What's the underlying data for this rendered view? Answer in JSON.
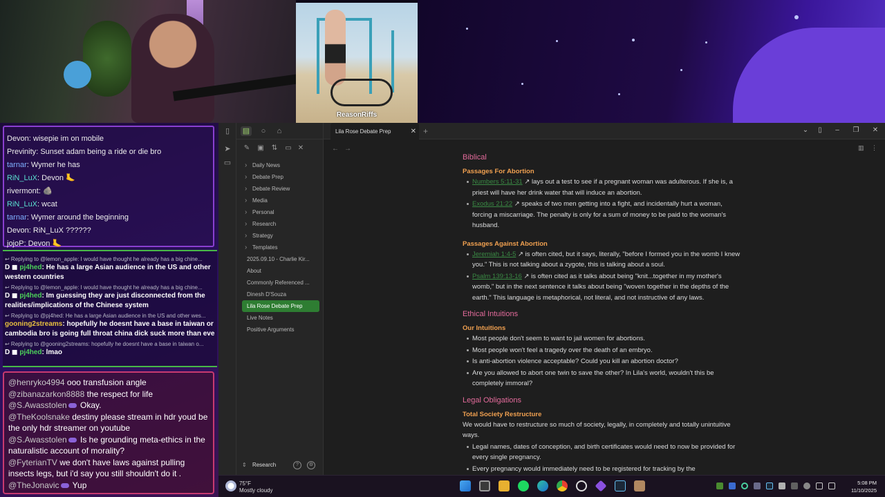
{
  "stream": {
    "overlay_tag": "ReasonRiffs"
  },
  "chat_top": [
    {
      "user": "Devon",
      "user_color": "#ececec",
      "text": "wisepie im on mobile"
    },
    {
      "user": "Previnity",
      "user_color": "#ececec",
      "text": "Sunset adam being a ride or die bro"
    },
    {
      "user": "tarnar",
      "user_color": "#7fb0ff",
      "text": "Wymer he has"
    },
    {
      "user": "RiN_LuX",
      "user_color": "#5ae0d0",
      "text": "Devon 🦶"
    },
    {
      "user": "rivermont",
      "user_color": "#ececec",
      "text": "🪨"
    },
    {
      "user": "RiN_LuX",
      "user_color": "#5ae0d0",
      "text": "wcat"
    },
    {
      "user": "tarnar",
      "user_color": "#7fb0ff",
      "text": "Wymer around the beginning"
    },
    {
      "user": "Devon",
      "user_color": "#ececec",
      "text": "RiN_LuX ??????"
    },
    {
      "user": "jojoP",
      "user_color": "#ececec",
      "text": "Devon 🦶"
    }
  ],
  "chat_mid": [
    {
      "reply": "↩ Replying to @lemon_apple: I would have thought he already has a big chine...",
      "user": "pj4hed",
      "user_color": "#4cd05a",
      "badge": "D ◼",
      "text": "He has a large Asian audience in the US and other western countries"
    },
    {
      "reply": "↩ Replying to @lemon_apple: I would have thought he already has a big chine...",
      "user": "pj4hed",
      "user_color": "#4cd05a",
      "badge": "D ◼",
      "text": "Im guessing they are just disconnected from the realities/implications of the Chinese system"
    },
    {
      "reply": "↩ Replying to @pj4hed: He has a large Asian audience in the US and other wes...",
      "user": "gooning2streams",
      "user_color": "#e8c040",
      "badge": "",
      "text": "hopefully he doesnt have a base in taiwan or cambodia bro is going full throat china dick suck more than eve"
    },
    {
      "reply": "↩ Replying to @gooning2streams: hopefully he doesnt have a base in taiwan o...",
      "user": "pj4hed",
      "user_color": "#4cd05a",
      "badge": "D ◼",
      "text": "lmao"
    }
  ],
  "chat_bottom": [
    {
      "user": "@henryko4994",
      "dot": false,
      "text": "ooo transfusion angle"
    },
    {
      "user": "@zibanazarkon8888",
      "dot": false,
      "text": "the respect for life"
    },
    {
      "user": "@S.Awasstolen",
      "dot": true,
      "text": "Okay."
    },
    {
      "user": "@TheKoolsnake",
      "dot": false,
      "text": "destiny please stream in hdr youd be the only hdr streamer on youtube"
    },
    {
      "user": "@S.Awasstolen",
      "dot": true,
      "text": "Is he grounding meta-ethics in the naturalistic account of morality?"
    },
    {
      "user": "@FyterianTV",
      "dot": false,
      "text": "we don't have laws against pulling insects legs, but i'd say you still shouldn't do it ."
    },
    {
      "user": "@TheJonavic",
      "dot": true,
      "text": "Yup"
    }
  ],
  "obsidian": {
    "tab_title": "Lila Rose Debate Prep",
    "sidebar_items": [
      {
        "label": "Daily News",
        "type": "folder"
      },
      {
        "label": "Debate Prep",
        "type": "folder"
      },
      {
        "label": "Debate Review",
        "type": "folder"
      },
      {
        "label": "Media",
        "type": "folder"
      },
      {
        "label": "Personal",
        "type": "folder"
      },
      {
        "label": "Research",
        "type": "folder"
      },
      {
        "label": "Strategy",
        "type": "folder"
      },
      {
        "label": "Templates",
        "type": "folder"
      },
      {
        "label": "2025.09.10 - Charlie Kir...",
        "type": "file"
      },
      {
        "label": "About",
        "type": "file"
      },
      {
        "label": "Commonly Referenced ...",
        "type": "file"
      },
      {
        "label": "Dinesh D'Souza",
        "type": "file"
      },
      {
        "label": "Lila Rose Debate Prep",
        "type": "file",
        "selected": true
      },
      {
        "label": "Live Notes",
        "type": "file"
      },
      {
        "label": "Positive Arguments",
        "type": "file"
      }
    ],
    "vault_name": "Research",
    "note": {
      "biblical": {
        "heading": "Biblical",
        "for": {
          "heading": "Passages For Abortion",
          "items": [
            {
              "link": "Numbers 5:11-31",
              "text": "lays out a test to see if a pregnant woman was adulterous. If she is, a priest will have her drink water that will induce an abortion."
            },
            {
              "link": "Exodus 21:22",
              "text": "speaks of two men getting into a fight, and incidentally hurt a woman, forcing a miscarriage. The penalty is only for a sum of money to be paid to the woman's husband."
            }
          ]
        },
        "against": {
          "heading": "Passages Against Abortion",
          "items": [
            {
              "link": "Jeremiah 1:4-5",
              "text": "is often cited, but it says, literally, \"before I formed you in the womb I knew you.\" This is not talking about a zygote, this is talking about a soul."
            },
            {
              "link": "Psalm 139:13-16",
              "text": "is often cited as it talks about being \"knit...together in my mother's womb,\" but in the next sentence it talks about being \"woven together in the depths of the earth.\" This language is metaphorical, not literal, and not instructive of any laws."
            }
          ]
        }
      },
      "ethical": {
        "heading": "Ethical Intuitions",
        "sub_heading": "Our Intuitions",
        "items": [
          "Most people don't seem to want to jail women for abortions.",
          "Most people won't feel a tragedy over the death of an embryo.",
          "Is anti-abortion violence acceptable? Could you kill an abortion doctor?",
          "Are you allowed to abort one twin to save the other? In Lila's world, wouldn't this be completely immoral?"
        ]
      },
      "legal": {
        "heading": "Legal Obligations",
        "sub_heading": "Total Society Restructure",
        "intro": "We would have to restructure so much of society, legally, in completely and totally unintuitive ways.",
        "items": [
          "Legal names, dates of conception, and birth certificates would need to now be provided for every single pregnancy.",
          "Every pregnancy would immediately need to be registered for tracking by the"
        ]
      }
    }
  },
  "taskbar": {
    "temp": "75°F",
    "weather": "Mostly cloudy",
    "time": "5:08 PM",
    "date": "11/10/2025"
  }
}
